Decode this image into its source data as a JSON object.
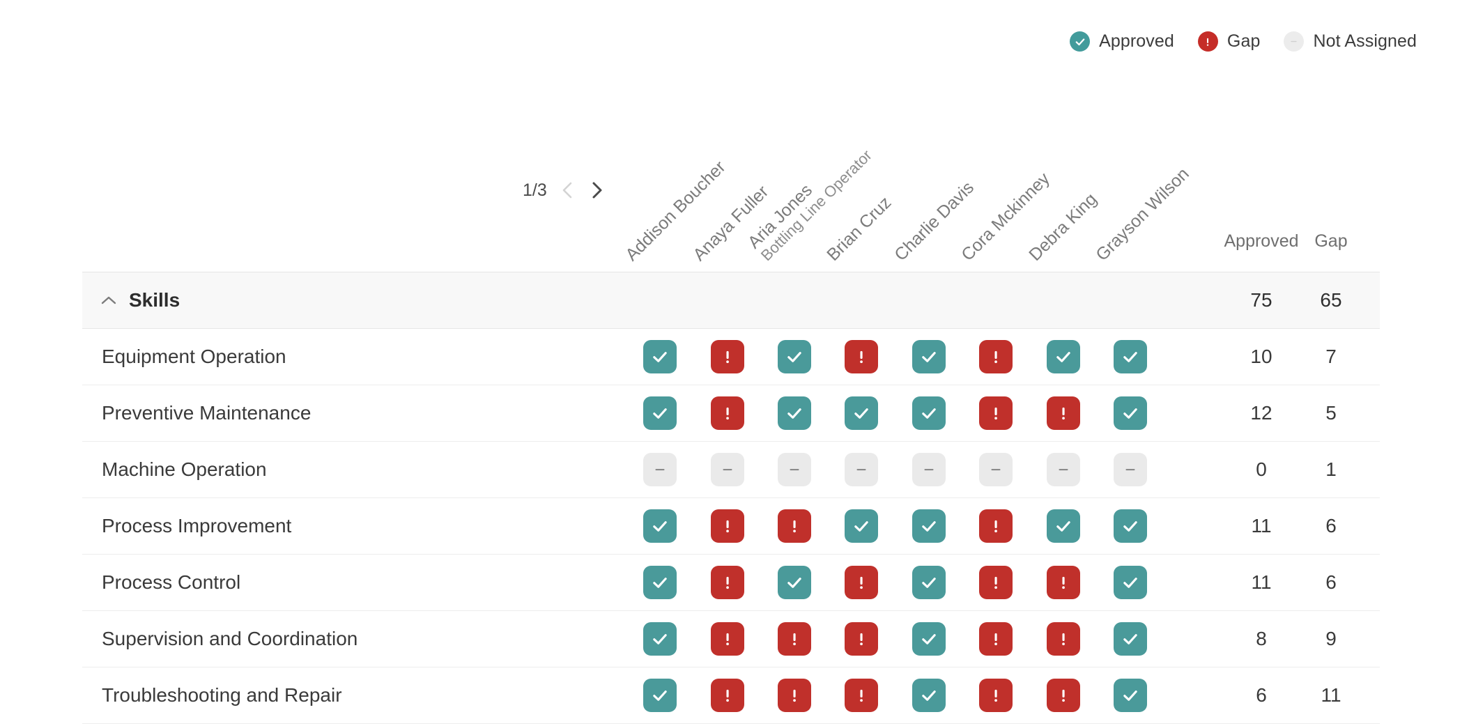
{
  "legend": {
    "items": [
      {
        "label": "Approved",
        "status": "approved",
        "icon": "check-circle-icon"
      },
      {
        "label": "Gap",
        "status": "gap",
        "icon": "exclamation-circle-icon"
      },
      {
        "label": "Not Assigned",
        "status": "notassigned",
        "icon": "dash-circle-icon"
      }
    ]
  },
  "pagination": {
    "label": "1/3",
    "prev_icon": "chevron-left-icon",
    "next_icon": "chevron-right-icon",
    "prev_enabled": false,
    "next_enabled": true
  },
  "people": [
    {
      "name": "Addison Boucher",
      "role": ""
    },
    {
      "name": "Anaya Fuller",
      "role": ""
    },
    {
      "name": "Aria Jones",
      "role": "Bottling Line Operator"
    },
    {
      "name": "Brian Cruz",
      "role": ""
    },
    {
      "name": "Charlie Davis",
      "role": ""
    },
    {
      "name": "Cora Mckinney",
      "role": ""
    },
    {
      "name": "Debra King",
      "role": ""
    },
    {
      "name": "Grayson Wilson",
      "role": ""
    }
  ],
  "summary_columns": [
    {
      "label": "Approved"
    },
    {
      "label": "Gap"
    }
  ],
  "group": {
    "title": "Skills",
    "caret_icon": "chevron-up-icon",
    "expanded": true,
    "approved": "75",
    "gap": "65"
  },
  "rows": [
    {
      "label": "Equipment Operation",
      "statuses": [
        "approved",
        "gap",
        "approved",
        "gap",
        "approved",
        "gap",
        "approved",
        "approved"
      ],
      "approved": "10",
      "gap": "7"
    },
    {
      "label": "Preventive Maintenance",
      "statuses": [
        "approved",
        "gap",
        "approved",
        "approved",
        "approved",
        "gap",
        "gap",
        "approved"
      ],
      "approved": "12",
      "gap": "5"
    },
    {
      "label": "Machine Operation",
      "statuses": [
        "notassigned",
        "notassigned",
        "notassigned",
        "notassigned",
        "notassigned",
        "notassigned",
        "notassigned",
        "notassigned"
      ],
      "approved": "0",
      "gap": "1"
    },
    {
      "label": "Process Improvement",
      "statuses": [
        "approved",
        "gap",
        "gap",
        "approved",
        "approved",
        "gap",
        "approved",
        "approved"
      ],
      "approved": "11",
      "gap": "6"
    },
    {
      "label": "Process Control",
      "statuses": [
        "approved",
        "gap",
        "approved",
        "gap",
        "approved",
        "gap",
        "gap",
        "approved"
      ],
      "approved": "11",
      "gap": "6"
    },
    {
      "label": "Supervision and Coordination",
      "statuses": [
        "approved",
        "gap",
        "gap",
        "gap",
        "approved",
        "gap",
        "gap",
        "approved"
      ],
      "approved": "8",
      "gap": "9"
    },
    {
      "label": "Troubleshooting and Repair",
      "statuses": [
        "approved",
        "gap",
        "gap",
        "gap",
        "approved",
        "gap",
        "gap",
        "approved"
      ],
      "approved": "6",
      "gap": "11"
    }
  ],
  "colors": {
    "approved": "#4a9a9a",
    "gap": "#c0302b",
    "not_assigned": "#eaeaea"
  }
}
